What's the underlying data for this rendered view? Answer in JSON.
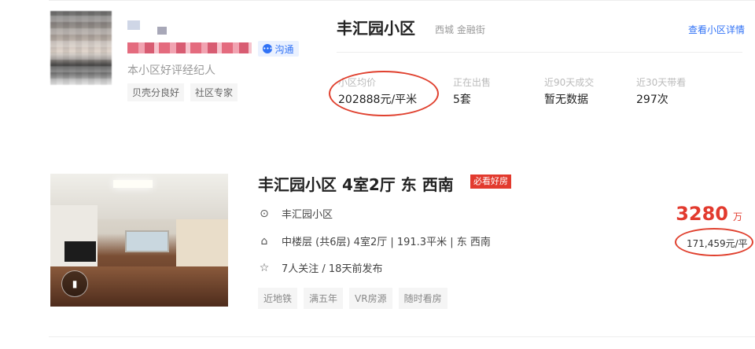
{
  "agent": {
    "description": "本小区好评经纪人",
    "chat_label": "沟通",
    "tags": [
      "贝壳分良好",
      "社区专家"
    ]
  },
  "community": {
    "name": "丰汇园小区",
    "location": "西城 金融街",
    "detail_link": "查看小区详情",
    "stats": [
      {
        "label": "小区均价",
        "value": "202888元/平米"
      },
      {
        "label": "正在出售",
        "value": "5套"
      },
      {
        "label": "近90天成交",
        "value": "暂无数据"
      },
      {
        "label": "近30天带看",
        "value": "297次"
      }
    ]
  },
  "listing": {
    "title": "丰汇园小区 4室2厅 东 西南",
    "badge": "必看好房",
    "community": "丰汇园小区",
    "house_info": "中楼层 (共6层) 4室2厅 | 191.3平米 | 东 西南",
    "follow_info": "7人关注 / 18天前发布",
    "tags": [
      "近地铁",
      "满五年",
      "VR房源",
      "随时看房"
    ],
    "total_price": "3280",
    "total_price_unit": "万",
    "unit_price": "171,459元/平"
  },
  "colors": {
    "accent_blue": "#3072f6",
    "price_red": "#e23a2e",
    "annotation_red": "#e0412f"
  }
}
